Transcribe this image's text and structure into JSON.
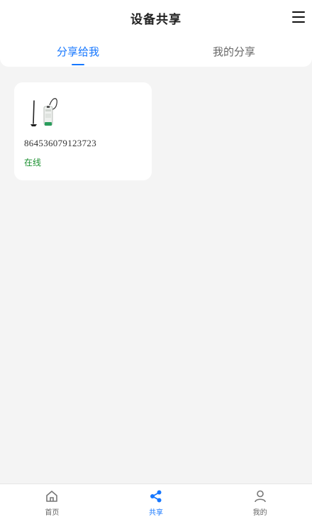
{
  "header": {
    "title": "设备共享",
    "menu_icon": "menu-icon"
  },
  "tabs": [
    {
      "label": "分享给我",
      "active": true
    },
    {
      "label": "我的分享",
      "active": false
    }
  ],
  "devices": [
    {
      "icon": "dtu-antenna-device-icon",
      "id": "864536079123723",
      "status": "在线",
      "status_color": "#1a8f2f"
    }
  ],
  "bottom_nav": {
    "items": [
      {
        "label": "首页",
        "icon": "home-icon",
        "active": false
      },
      {
        "label": "共享",
        "icon": "share-icon",
        "active": true
      },
      {
        "label": "我的",
        "icon": "user-icon",
        "active": false
      }
    ]
  },
  "colors": {
    "accent": "#1677ff",
    "background": "#f4f4f4",
    "online": "#1a8f2f"
  }
}
